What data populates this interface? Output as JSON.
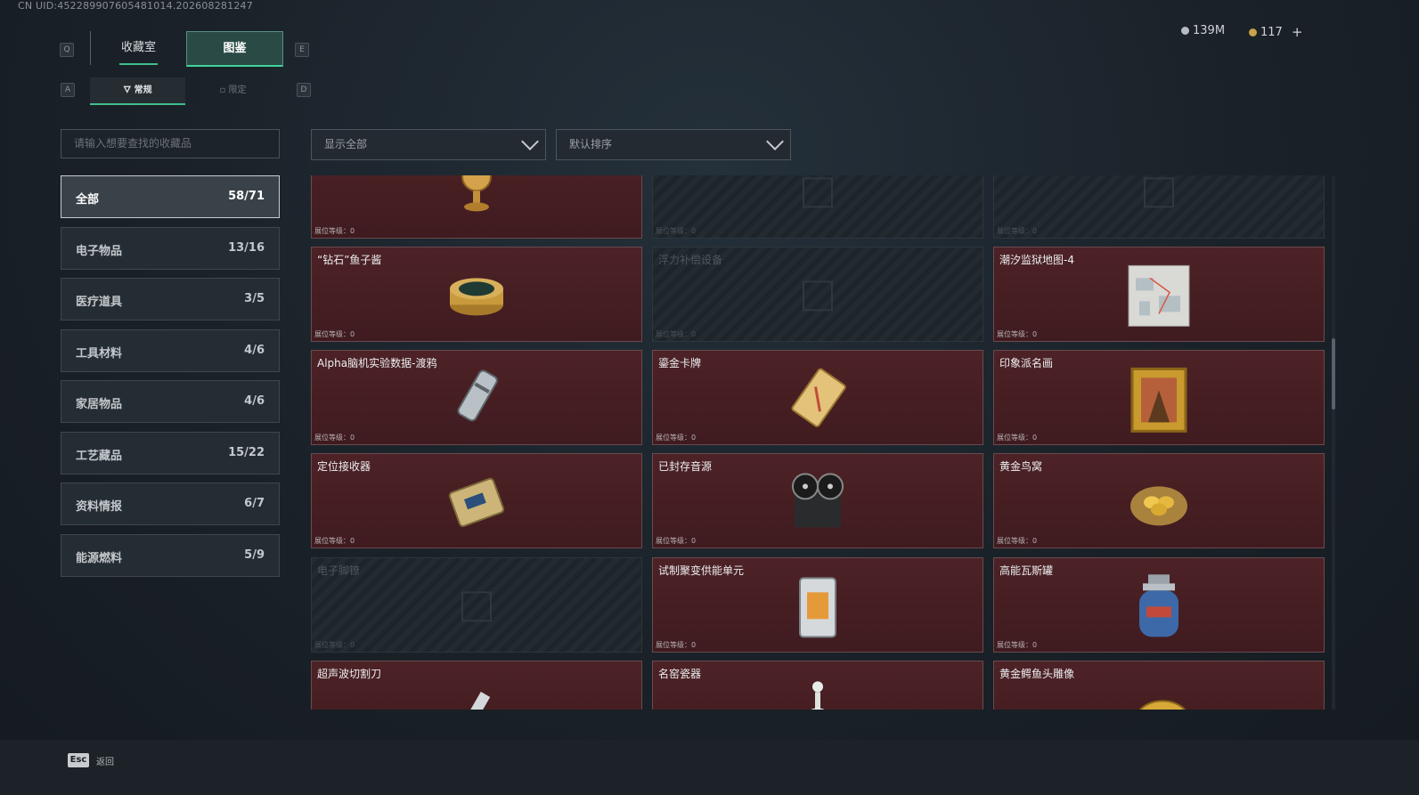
{
  "uid": "CN UID:4522899076054810​14.20260828​1247",
  "keys": {
    "q": "Q",
    "e": "E",
    "a": "A",
    "d": "D"
  },
  "tabs": [
    "收藏室",
    "图鉴"
  ],
  "subtabs": [
    "常规",
    "限定"
  ],
  "currency": {
    "silver": "139M",
    "gold": "117",
    "plus": "+"
  },
  "search_placeholder": "请输入想要查找的收藏品",
  "filter": "显示全部",
  "sort": "默认排序",
  "categories": [
    {
      "name": "全部",
      "count": "58/71"
    },
    {
      "name": "电子物品",
      "count": "13/16"
    },
    {
      "name": "医疗道具",
      "count": "3/5"
    },
    {
      "name": "工具材料",
      "count": "4/6"
    },
    {
      "name": "家居物品",
      "count": "4/6"
    },
    {
      "name": "工艺藏品",
      "count": "15/22"
    },
    {
      "name": "资料情报",
      "count": "6/7"
    },
    {
      "name": "能源燃料",
      "count": "5/9"
    }
  ],
  "level_label": "展位等级：0",
  "items": [
    {
      "title": "",
      "locked": false,
      "icon": "gold-trophy-icon"
    },
    {
      "title": "",
      "locked": true,
      "icon": "locked-item-icon"
    },
    {
      "title": "",
      "locked": true,
      "icon": "locked-item-icon"
    },
    {
      "title": "“钻石”鱼子酱",
      "locked": false,
      "icon": "caviar-tin-icon"
    },
    {
      "title": "浮力补偿设备",
      "locked": true,
      "icon": "locked-item-icon"
    },
    {
      "title": "潮汐监狱地图-4",
      "locked": false,
      "icon": "map-icon"
    },
    {
      "title": "Alpha脑机实验数据-渡鸦",
      "locked": false,
      "icon": "data-canister-icon"
    },
    {
      "title": "鎏金卡牌",
      "locked": false,
      "icon": "gold-card-icon"
    },
    {
      "title": "印象派名画",
      "locked": false,
      "icon": "painting-icon"
    },
    {
      "title": "定位接收器",
      "locked": false,
      "icon": "receiver-icon"
    },
    {
      "title": "已封存音源",
      "locked": false,
      "icon": "tape-recorder-icon"
    },
    {
      "title": "黄金鸟窝",
      "locked": false,
      "icon": "golden-nest-icon"
    },
    {
      "title": "电子脚镣",
      "locked": true,
      "icon": "locked-item-icon"
    },
    {
      "title": "试制聚变供能单元",
      "locked": false,
      "icon": "fusion-cell-icon"
    },
    {
      "title": "高能瓦斯罐",
      "locked": false,
      "icon": "gas-canister-icon"
    },
    {
      "title": "超声波切割刀",
      "locked": false,
      "icon": "cutter-icon"
    },
    {
      "title": "名窑瓷器",
      "locked": false,
      "icon": "porcelain-icon"
    },
    {
      "title": "黄金鳄鱼头雕像",
      "locked": false,
      "icon": "gold-crocodile-icon"
    }
  ],
  "footer": {
    "key": "Esc",
    "label": "返回"
  }
}
